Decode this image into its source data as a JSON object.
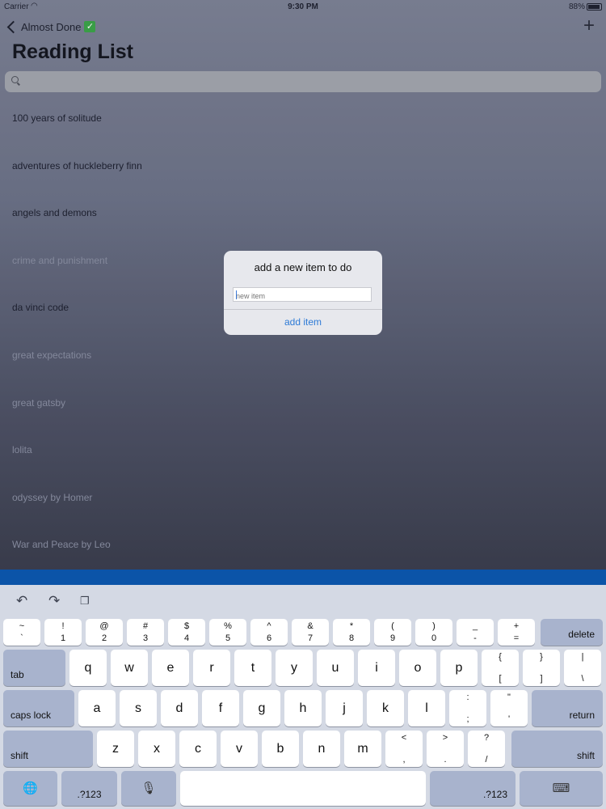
{
  "status": {
    "carrier": "Carrier",
    "wifi_icon": "wifi-icon",
    "time": "9:30 PM",
    "battery": "88%"
  },
  "nav": {
    "back_label": "Almost Done",
    "add_icon": "+"
  },
  "title": "Reading List",
  "items": [
    {
      "label": "100 years of solitude",
      "color": "#1e2130"
    },
    {
      "label": "adventures of huckleberry finn",
      "color": "#1e2130"
    },
    {
      "label": "angels and demons",
      "color": "#1e2130"
    },
    {
      "label": "crime and punishment",
      "color": "#8a8fa2"
    },
    {
      "label": "da vinci code",
      "color": "#1e2130"
    },
    {
      "label": "great expectations",
      "color": "#8a8fa2"
    },
    {
      "label": "great gatsby",
      "color": "#8a8fa2"
    },
    {
      "label": "lolita",
      "color": "#8a8fa2"
    },
    {
      "label": "odyssey by Homer",
      "color": "#8a8fa2"
    },
    {
      "label": "War and Peace by Leo",
      "color": "#8a8fa2"
    }
  ],
  "alert": {
    "title": "add a new item to do",
    "placeholder": "new item",
    "button": "add item"
  },
  "keyboard": {
    "row1": [
      {
        "t": "~",
        "b": "`"
      },
      {
        "t": "!",
        "b": "1"
      },
      {
        "t": "@",
        "b": "2"
      },
      {
        "t": "#",
        "b": "3"
      },
      {
        "t": "$",
        "b": "4"
      },
      {
        "t": "%",
        "b": "5"
      },
      {
        "t": "^",
        "b": "6"
      },
      {
        "t": "&",
        "b": "7"
      },
      {
        "t": "*",
        "b": "8"
      },
      {
        "t": "(",
        "b": "9"
      },
      {
        "t": ")",
        "b": "0"
      },
      {
        "t": "_",
        "b": "-"
      },
      {
        "t": "+",
        "b": "="
      }
    ],
    "row2": [
      "q",
      "w",
      "e",
      "r",
      "t",
      "y",
      "u",
      "i",
      "o",
      "p"
    ],
    "row2_extra": [
      {
        "t": "{",
        "b": "["
      },
      {
        "t": "}",
        "b": "]"
      },
      {
        "t": "|",
        "b": "\\"
      }
    ],
    "row3": [
      "a",
      "s",
      "d",
      "f",
      "g",
      "h",
      "j",
      "k",
      "l"
    ],
    "row3_extra": [
      {
        "t": ":",
        "b": ";"
      },
      {
        "t": "\"",
        "b": "'"
      }
    ],
    "row4": [
      "z",
      "x",
      "c",
      "v",
      "b",
      "n",
      "m"
    ],
    "row4_extra": [
      {
        "t": "<",
        "b": ","
      },
      {
        "t": ">",
        "b": "."
      },
      {
        "t": "?",
        "b": "/"
      }
    ],
    "labels": {
      "delete": "delete",
      "tab": "tab",
      "caps": "caps lock",
      "ret": "return",
      "shift": "shift",
      "num": ".?123"
    }
  }
}
